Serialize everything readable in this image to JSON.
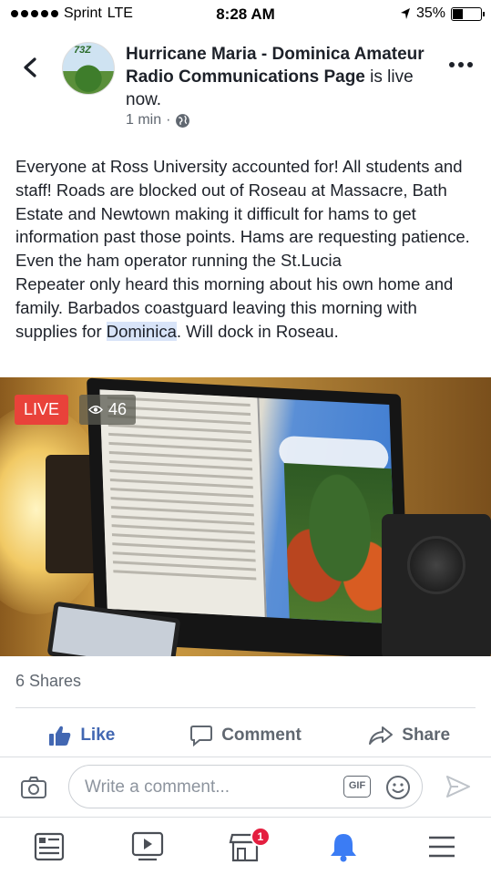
{
  "status_bar": {
    "carrier": "Sprint",
    "network": "LTE",
    "time": "8:28 AM",
    "battery": "35%"
  },
  "post": {
    "title_bold": "Hurricane Maria - Dominica Amateur Radio Communications Page",
    "title_suffix": " is live now.",
    "time": "1 min",
    "separator": "·",
    "text_before": "Everyone at Ross University accounted for! All students and staff! Roads are blocked out of Roseau at Massacre, Bath Estate and Newtown making it difficult for hams to get information past those points. Hams are requesting patience. Even the ham operator running the St.Lucia\nRepeater only heard this morning about his own home and family. Barbados coastguard leaving this morning with supplies for ",
    "text_highlight": "Dominica",
    "text_after": ". Will dock in Roseau.",
    "avatar_tag": "73Z"
  },
  "video": {
    "live_label": "LIVE",
    "viewer_count": "46"
  },
  "shares": "6 Shares",
  "actions": {
    "like": "Like",
    "comment": "Comment",
    "share": "Share"
  },
  "comment_box": {
    "placeholder": "Write a comment...",
    "gif_label": "GIF"
  },
  "tabbar": {
    "marketplace_badge": "1"
  },
  "colors": {
    "brand_blue": "#4267b2",
    "live_red": "#e9423a",
    "badge_red": "#e41e3f",
    "notification_blue": "#3b7cf4"
  }
}
